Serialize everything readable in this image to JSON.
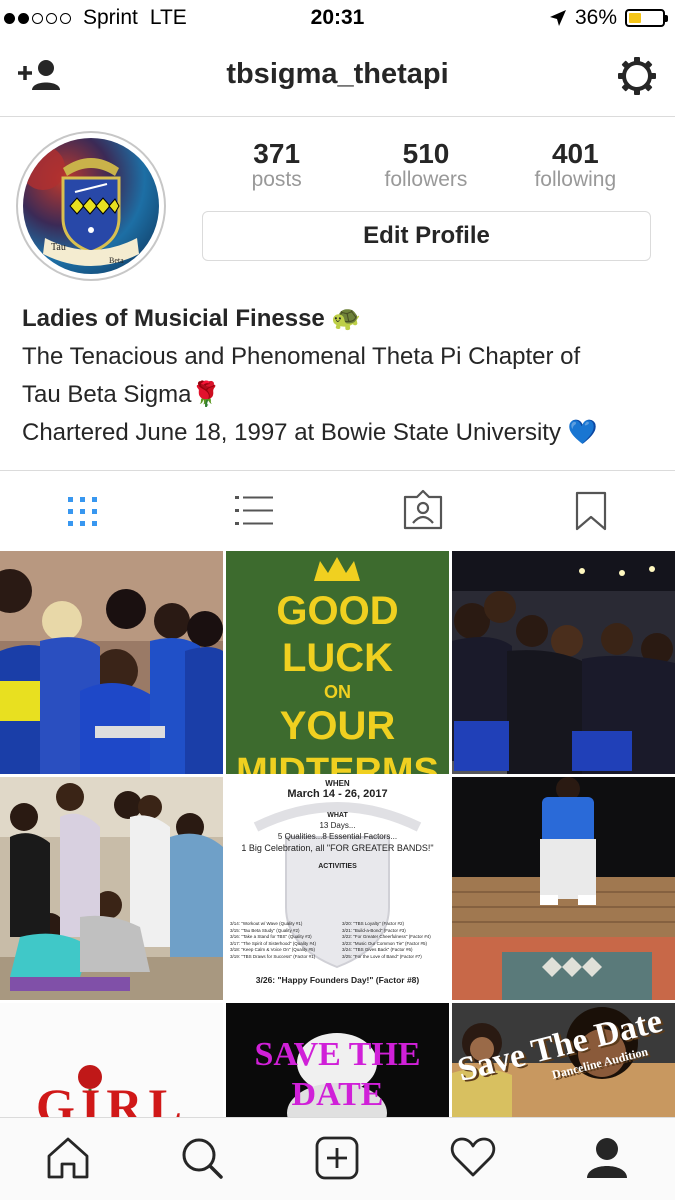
{
  "status_bar": {
    "carrier": "Sprint",
    "network": "LTE",
    "time": "20:31",
    "battery": "36%",
    "signal_bars_filled": 2,
    "signal_bars_total": 5,
    "battery_level": 0.36
  },
  "header": {
    "username": "tbsigma_thetapi",
    "icons": [
      "add-user-icon",
      "gear-icon"
    ]
  },
  "profile": {
    "avatar_labels": [
      "Tau",
      "Beta"
    ],
    "stats": [
      {
        "value": "371",
        "label": "posts"
      },
      {
        "value": "510",
        "label": "followers"
      },
      {
        "value": "401",
        "label": "following"
      }
    ],
    "edit_button": "Edit Profile"
  },
  "bio": {
    "name": "Ladies of Musicial Finesse 🐢",
    "line1": "The Tenacious and Phenomenal Theta Pi Chapter of",
    "line2": "Tau Beta Sigma🌹",
    "line3": "Chartered June 18, 1997 at Bowie State University 💙"
  },
  "tabs": [
    "grid-icon",
    "list-icon",
    "tagged-icon",
    "bookmark-icon"
  ],
  "posts": {
    "post2": {
      "line1": "GOOD",
      "line2": "LUCK",
      "line3": "ON",
      "line4": "YOUR",
      "line5": "MIDTERMS"
    },
    "post5": {
      "when_label": "WHEN",
      "dates": "March 14 - 26, 2017",
      "what_label": "WHAT",
      "days": "13 Days...",
      "factors": "5 Qualities...8 Essential Factors...",
      "celebration": "1 Big Celebration, all \"FOR GREATER BANDS!\"",
      "activities_label": "ACTIVITIES",
      "left_list": [
        "3/14: \"Workout w/ Wave (Quality #1)",
        "3/15: \"Tau Beta Study\" (Quality #2)",
        "3/16: \"Take a Stand for TBS\" (Quality #3)",
        "3/17: \"The Spirit of Sisterhood\" (Quality #4)",
        "3/18: \"Keep Calm & Voice On\" (Quality #5)",
        "3/19: \"TBS Draws for Success\" (Factor #1)"
      ],
      "right_list": [
        "3/20: \"TBS Loyalty\" (Factor #2)",
        "3/21: \"Build-a-Bond\" (Factor #3)",
        "3/22: \"For Greater Cheerfulness\" (Factor #4)",
        "3/23: \"Music Our Common Tie\" (Factor #5)",
        "3/24: \"TBS Gives Back\" (Factor #6)",
        "3/25: \"For the Love of Band\" (Factor #7)"
      ],
      "footer": "3/26: \"Happy Founders Day!\" (Factor #8)"
    },
    "post7": {
      "text": "GIRL"
    },
    "post8": {
      "line1": "SAVE THE",
      "line2": "DATE"
    },
    "post9": {
      "line1": "Save The Date",
      "line2": "Danceline Audition"
    }
  },
  "bottom_nav": [
    "home-icon",
    "search-icon",
    "add-post-icon",
    "heart-icon",
    "profile-icon"
  ],
  "colors": {
    "accent": "#3897f0",
    "border": "#dbdbdb",
    "text": "#262626",
    "muted": "#999999",
    "battery": "#f5c518"
  }
}
